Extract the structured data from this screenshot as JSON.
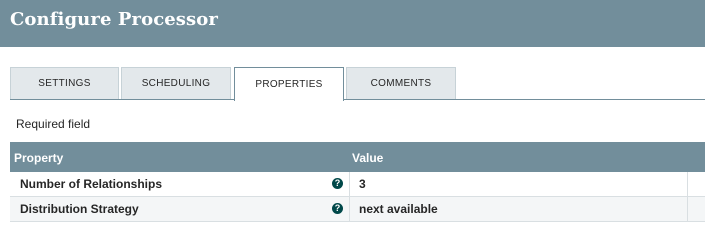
{
  "dialog": {
    "title": "Configure Processor"
  },
  "tabs": [
    {
      "label": "SETTINGS",
      "active": false
    },
    {
      "label": "SCHEDULING",
      "active": false
    },
    {
      "label": "PROPERTIES",
      "active": true
    },
    {
      "label": "COMMENTS",
      "active": false
    }
  ],
  "properties": {
    "required_note": "Required field",
    "columns": {
      "property": "Property",
      "value": "Value"
    },
    "rows": [
      {
        "name": "Number of Relationships",
        "help_icon": "question-circle-icon",
        "help_glyph": "?",
        "value": "3"
      },
      {
        "name": "Distribution Strategy",
        "help_icon": "question-circle-icon",
        "help_glyph": "?",
        "value": "next available"
      }
    ]
  },
  "colors": {
    "header": "#728e9b",
    "tab_inactive": "#e3e8eb",
    "help_icon": "#004849"
  }
}
